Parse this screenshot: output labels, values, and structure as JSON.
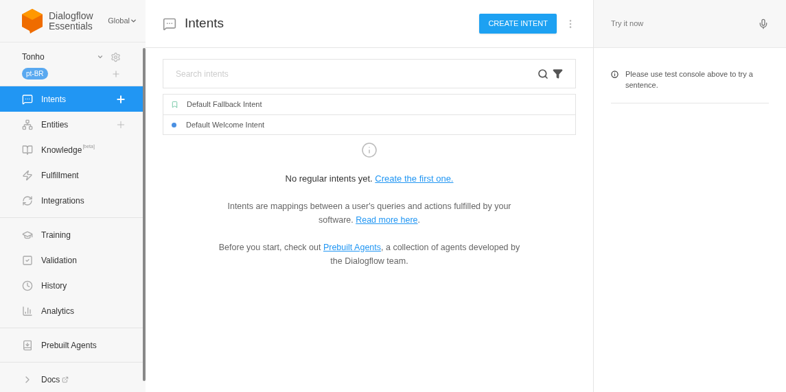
{
  "brand": {
    "name": "Dialogflow",
    "subname": "Essentials",
    "region": "Global"
  },
  "agent": {
    "name": "Tonho",
    "language": "pt-BR"
  },
  "sidebar": {
    "sections": [
      {
        "items": [
          {
            "label": "Intents",
            "selected": true,
            "add": true
          },
          {
            "label": "Entities",
            "selected": false,
            "add": true
          },
          {
            "label": "Knowledge",
            "selected": false,
            "add": false,
            "badge": "[beta]"
          },
          {
            "label": "Fulfillment",
            "selected": false,
            "add": false
          },
          {
            "label": "Integrations",
            "selected": false,
            "add": false
          }
        ]
      },
      {
        "items": [
          {
            "label": "Training",
            "selected": false,
            "add": false
          },
          {
            "label": "Validation",
            "selected": false,
            "add": false
          },
          {
            "label": "History",
            "selected": false,
            "add": false
          },
          {
            "label": "Analytics",
            "selected": false,
            "add": false
          }
        ]
      },
      {
        "items": [
          {
            "label": "Prebuilt Agents",
            "selected": false,
            "add": false
          }
        ]
      },
      {
        "items": [
          {
            "label": "Docs",
            "selected": false,
            "add": false,
            "kind": "external"
          }
        ]
      }
    ]
  },
  "header": {
    "title": "Intents",
    "button": "CREATE INTENT"
  },
  "search": {
    "placeholder": "Search intents"
  },
  "intents": [
    {
      "name": "Default Fallback Intent",
      "kind": "fallback"
    },
    {
      "name": "Default Welcome Intent",
      "kind": "welcome",
      "color": "#4a90e2"
    }
  ],
  "empty_state": [
    [
      {
        "text": "No regular intents yet. "
      },
      {
        "text": "Create the first one.",
        "link": true
      }
    ],
    [
      {
        "text": "Intents are mappings between a user's queries and actions fulfilled by your software. "
      },
      {
        "text": "Read more here",
        "link": true
      },
      {
        "text": "."
      }
    ],
    [
      {
        "text": "Before you start, check out "
      },
      {
        "text": "Prebuilt Agents",
        "link": true
      },
      {
        "text": ", a collection of agents developed by the Dialogflow team."
      }
    ]
  ],
  "console": {
    "placeholder": "Try it now",
    "message": "Please use test console above to try a sentence."
  }
}
